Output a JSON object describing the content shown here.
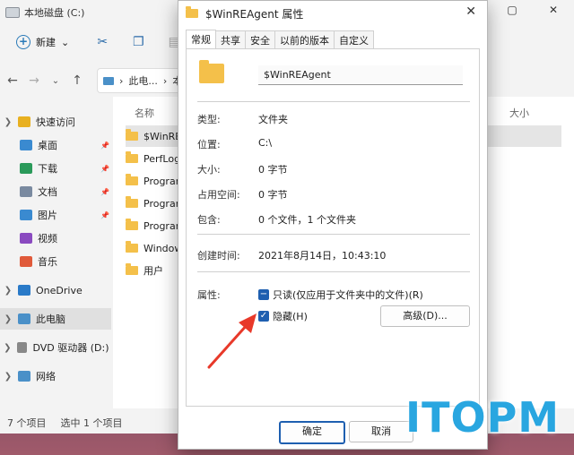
{
  "explorer": {
    "title": "本地磁盘 (C:)",
    "window_buttons": [
      "—",
      "▢",
      "✕"
    ],
    "toolbar": {
      "new_label": "新建",
      "new_chevron": "⌄"
    },
    "breadcrumb": [
      "此电...",
      "本"
    ],
    "sidebar": [
      {
        "label": "快速访问",
        "icon": "star-icon",
        "chevron": "❯",
        "pinned": false
      },
      {
        "label": "桌面",
        "icon": "desktop-icon",
        "pinned": true
      },
      {
        "label": "下载",
        "icon": "download-icon",
        "pinned": true
      },
      {
        "label": "文档",
        "icon": "documents-icon",
        "pinned": true
      },
      {
        "label": "图片",
        "icon": "pictures-icon",
        "pinned": true
      },
      {
        "label": "视频",
        "icon": "videos-icon",
        "pinned": false
      },
      {
        "label": "音乐",
        "icon": "music-icon",
        "pinned": false
      },
      {
        "label": "OneDrive",
        "icon": "cloud-icon",
        "chevron": "❯",
        "pinned": false
      },
      {
        "label": "此电脑",
        "icon": "pc-icon",
        "chevron": "❯",
        "pinned": false,
        "selected": true
      },
      {
        "label": "DVD 驱动器 (D:) CF",
        "icon": "dvd-icon",
        "chevron": "❯",
        "pinned": false
      },
      {
        "label": "网络",
        "icon": "network-icon",
        "chevron": "❯",
        "pinned": false
      }
    ],
    "columns": {
      "name": "名称",
      "size": "大小"
    },
    "files": [
      {
        "name": "$WinREA",
        "selected": true
      },
      {
        "name": "PerfLogs"
      },
      {
        "name": "Program"
      },
      {
        "name": "Program"
      },
      {
        "name": "Program"
      },
      {
        "name": "Windows"
      },
      {
        "name": "用户"
      }
    ],
    "status": {
      "count": "7 个项目",
      "selected": "选中 1 个项目"
    }
  },
  "dialog": {
    "title": "$WinREAgent 属性",
    "close": "✕",
    "tabs": [
      "常规",
      "共享",
      "安全",
      "以前的版本",
      "自定义"
    ],
    "active_tab": 0,
    "name_value": "$WinREAgent",
    "props": [
      {
        "label": "类型:",
        "value": "文件夹"
      },
      {
        "label": "位置:",
        "value": "C:\\"
      },
      {
        "label": "大小:",
        "value": "0 字节"
      },
      {
        "label": "占用空间:",
        "value": "0 字节"
      },
      {
        "label": "包含:",
        "value": "0 个文件，1 个文件夹"
      }
    ],
    "created": {
      "label": "创建时间:",
      "value": "2021年8月14日，10:43:10"
    },
    "attributes": {
      "label": "属性:",
      "readonly": {
        "label": "只读(仅应用于文件夹中的文件)(R)",
        "mark": "−",
        "state": "indeterminate"
      },
      "hidden": {
        "label": "隐藏(H)",
        "mark": "✓",
        "state": "checked"
      },
      "advanced_label": "高级(D)..."
    },
    "ok_label": "确定",
    "cancel_label": "取消"
  },
  "watermark": "ITOPM",
  "colors": {
    "accent": "#1e5fb0",
    "annotation_arrow": "#e8392a",
    "watermark": "#29a6e0"
  }
}
